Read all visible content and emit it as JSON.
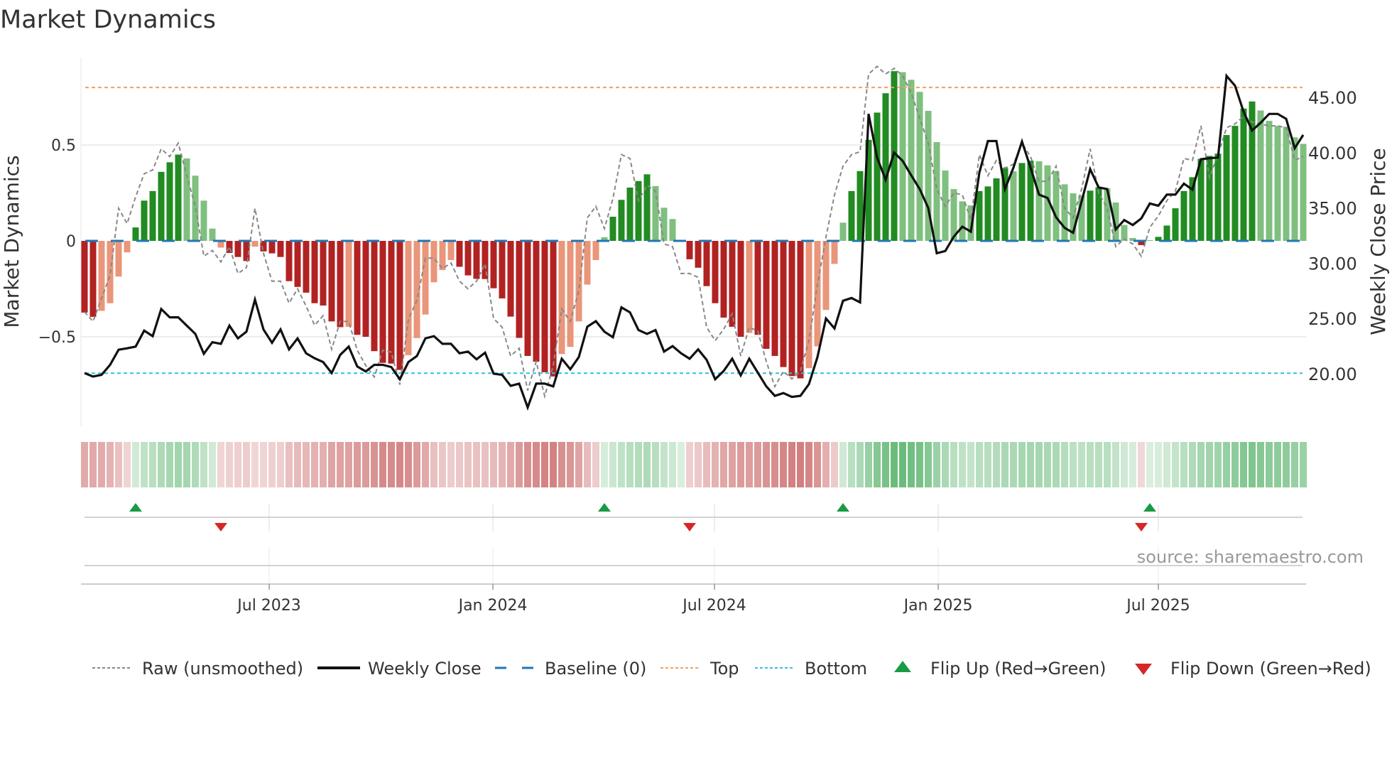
{
  "title": "Market Dynamics",
  "source": "source: sharemaestro.com",
  "colors": {
    "strong_green": "#228b22",
    "weak_green": "#7fbf7f",
    "strong_red": "#b22222",
    "weak_red": "#e9967a",
    "raw": "#888888",
    "close": "#111111",
    "baseline": "#1f77b4",
    "top": "#f0a060",
    "bottom": "#2ec4d8",
    "flip_up": "#1a9a46",
    "flip_down": "#d62728",
    "heat_green": "#239b3c",
    "heat_red": "#b22222"
  },
  "chart_data": {
    "type": "bar",
    "title": "Market Dynamics",
    "ylabel": "Market Dynamics",
    "y2label": "Weekly Close Price",
    "ylim": [
      -0.967,
      0.956
    ],
    "y2lim": [
      15.24,
      48.6
    ],
    "yticks": [
      {
        "v": 0.5,
        "label": "0.5"
      },
      {
        "v": 0,
        "label": "0"
      },
      {
        "v": -0.5,
        "label": "−0.5"
      }
    ],
    "y2ticks": [
      {
        "v": 45,
        "label": "45.00"
      },
      {
        "v": 40,
        "label": "40.00"
      },
      {
        "v": 35,
        "label": "35.00"
      },
      {
        "v": 30,
        "label": "30.00"
      },
      {
        "v": 25,
        "label": "25.00"
      },
      {
        "v": 20,
        "label": "20.00"
      }
    ],
    "xticks": [
      {
        "week": 21.67,
        "label": "Jul 2023"
      },
      {
        "week": 47.92,
        "label": "Jan 2024"
      },
      {
        "week": 73.92,
        "label": "Jul 2024"
      },
      {
        "week": 100.17,
        "label": "Jan 2025"
      },
      {
        "week": 126.0,
        "label": "Jul 2025"
      }
    ],
    "top_level": 0.8,
    "bottom_level": -0.69,
    "baseline": 0,
    "values": [
      -0.374,
      -0.396,
      -0.365,
      -0.325,
      -0.186,
      -0.06,
      0.07,
      0.21,
      0.26,
      0.36,
      0.41,
      0.45,
      0.43,
      0.34,
      0.21,
      0.064,
      -0.035,
      -0.063,
      -0.084,
      -0.105,
      -0.03,
      -0.055,
      -0.065,
      -0.084,
      -0.21,
      -0.24,
      -0.27,
      -0.325,
      -0.337,
      -0.42,
      -0.45,
      -0.448,
      -0.49,
      -0.5,
      -0.575,
      -0.636,
      -0.64,
      -0.673,
      -0.596,
      -0.507,
      -0.384,
      -0.216,
      -0.152,
      -0.1,
      -0.135,
      -0.18,
      -0.198,
      -0.199,
      -0.247,
      -0.3,
      -0.395,
      -0.506,
      -0.6,
      -0.63,
      -0.685,
      -0.707,
      -0.59,
      -0.553,
      -0.42,
      -0.228,
      -0.1,
      0.019,
      0.126,
      0.214,
      0.278,
      0.312,
      0.347,
      0.286,
      0.173,
      0.114,
      0.004,
      -0.096,
      -0.14,
      -0.236,
      -0.325,
      -0.4,
      -0.448,
      -0.5,
      -0.48,
      -0.49,
      -0.563,
      -0.6,
      -0.658,
      -0.705,
      -0.717,
      -0.664,
      -0.55,
      -0.36,
      -0.12,
      0.095,
      0.26,
      0.364,
      0.527,
      0.669,
      0.77,
      0.885,
      0.88,
      0.84,
      0.777,
      0.678,
      0.515,
      0.367,
      0.27,
      0.206,
      0.185,
      0.26,
      0.284,
      0.326,
      0.38,
      0.363,
      0.406,
      0.418,
      0.415,
      0.394,
      0.364,
      0.295,
      0.248,
      0.237,
      0.262,
      0.28,
      0.274,
      0.2,
      0.083,
      0.015,
      -0.022,
      0.004,
      0.021,
      0.08,
      0.17,
      0.26,
      0.332,
      0.428,
      0.443,
      0.455,
      0.552,
      0.6,
      0.69,
      0.727,
      0.68,
      0.626,
      0.6,
      0.595,
      0.54,
      0.506
    ],
    "raw": [
      -0.37,
      -0.42,
      -0.3,
      -0.18,
      0.17,
      0.09,
      0.23,
      0.35,
      0.37,
      0.48,
      0.44,
      0.51,
      0.34,
      0.18,
      -0.08,
      -0.05,
      -0.11,
      -0.03,
      -0.17,
      -0.14,
      0.17,
      -0.065,
      -0.21,
      -0.21,
      -0.325,
      -0.25,
      -0.34,
      -0.44,
      -0.39,
      -0.565,
      -0.42,
      -0.42,
      -0.57,
      -0.65,
      -0.71,
      -0.57,
      -0.58,
      -0.75,
      -0.41,
      -0.31,
      -0.09,
      -0.09,
      -0.145,
      -0.115,
      -0.21,
      -0.25,
      -0.21,
      -0.12,
      -0.405,
      -0.45,
      -0.6,
      -0.56,
      -0.78,
      -0.63,
      -0.81,
      -0.65,
      -0.355,
      -0.42,
      -0.26,
      0.12,
      0.18,
      0.064,
      0.22,
      0.45,
      0.43,
      0.21,
      0.29,
      0.26,
      -0.016,
      -0.03,
      -0.17,
      -0.17,
      -0.19,
      -0.45,
      -0.52,
      -0.46,
      -0.38,
      -0.6,
      -0.45,
      -0.47,
      -0.63,
      -0.76,
      -0.68,
      -0.72,
      -0.68,
      -0.52,
      -0.23,
      0.02,
      0.24,
      0.39,
      0.45,
      0.465,
      0.87,
      0.91,
      0.87,
      0.9,
      0.86,
      0.77,
      0.64,
      0.51,
      0.27,
      0.18,
      0.25,
      0.24,
      0.11,
      0.45,
      0.34,
      0.42,
      0.38,
      0.4,
      0.51,
      0.44,
      0.31,
      0.31,
      0.39,
      0.17,
      0.12,
      0.27,
      0.48,
      0.25,
      0.17,
      -0.03,
      0.01,
      -0.016,
      -0.08,
      0.07,
      0.13,
      0.21,
      0.26,
      0.43,
      0.42,
      0.6,
      0.33,
      0.45,
      0.59,
      0.61,
      0.65,
      0.62,
      0.61,
      0.6,
      0.6,
      0.59,
      0.42,
      0.44
    ],
    "close": [
      20.06,
      19.74,
      19.9,
      20.8,
      22.17,
      22.3,
      22.45,
      23.9,
      23.4,
      25.85,
      25.1,
      25.1,
      24.35,
      23.6,
      21.8,
      22.85,
      22.7,
      24.35,
      23.2,
      23.8,
      26.7,
      24.0,
      22.8,
      24.0,
      22.2,
      23.2,
      21.85,
      21.4,
      21.05,
      20.06,
      21.7,
      22.45,
      20.65,
      20.2,
      20.8,
      20.8,
      20.6,
      19.5,
      21.05,
      21.6,
      23.2,
      23.4,
      22.7,
      22.7,
      21.85,
      22.0,
      21.3,
      21.9,
      20.0,
      19.9,
      18.9,
      19.1,
      16.95,
      19.1,
      19.1,
      18.85,
      21.35,
      20.4,
      21.5,
      24.25,
      24.75,
      23.8,
      23.3,
      26.0,
      25.55,
      23.95,
      23.6,
      23.95,
      22.0,
      22.5,
      21.85,
      21.35,
      22.2,
      21.25,
      19.5,
      20.25,
      21.35,
      19.85,
      21.35,
      20.1,
      18.85,
      18.0,
      18.25,
      17.9,
      18.0,
      19.05,
      21.5,
      25.0,
      24.1,
      26.6,
      26.85,
      26.45,
      43.5,
      39.55,
      37.55,
      40.0,
      39.25,
      37.95,
      36.7,
      35.0,
      30.9,
      31.1,
      32.4,
      33.3,
      32.85,
      38.2,
      41.05,
      41.05,
      36.7,
      38.65,
      41.0,
      38.65,
      36.2,
      35.9,
      34.15,
      33.2,
      32.75,
      35.6,
      38.5,
      36.85,
      36.7,
      33.05,
      33.9,
      33.45,
      34.05,
      35.4,
      35.2,
      36.2,
      36.2,
      37.2,
      36.65,
      39.4,
      39.5,
      39.55,
      46.95,
      46.05,
      43.7,
      42.0,
      42.7,
      43.5,
      43.5,
      43.05,
      40.4,
      41.6
    ],
    "legend": {
      "placement": "bottom",
      "items": [
        {
          "key": "raw",
          "label": "Raw (unsmoothed)"
        },
        {
          "key": "close",
          "label": "Weekly Close"
        },
        {
          "key": "baseline",
          "label": "Baseline (0)"
        },
        {
          "key": "top",
          "label": "Top"
        },
        {
          "key": "bottom",
          "label": "Bottom"
        },
        {
          "key": "flip_up",
          "label": "Flip Up (Red→Green)"
        },
        {
          "key": "flip_down",
          "label": "Flip Down (Green→Red)"
        }
      ]
    }
  }
}
